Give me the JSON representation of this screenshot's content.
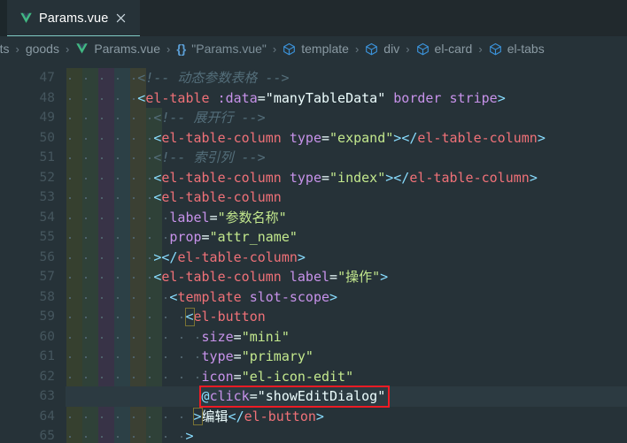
{
  "window": {
    "theme_bg": "#263238",
    "accent": "#80cbc4",
    "annotation_color": "#ee1b24"
  },
  "tabbar": {
    "tabs": [
      {
        "label": "Params.vue",
        "icon": "vue-icon",
        "close_icon": "close-icon",
        "active": true
      }
    ]
  },
  "breadcrumb": {
    "items": [
      {
        "label": "ents",
        "icon": null
      },
      {
        "label": "goods",
        "icon": null
      },
      {
        "label": "Params.vue",
        "icon": "vue-icon"
      },
      {
        "label": "\"Params.vue\"",
        "icon": "braces-icon"
      },
      {
        "label": "template",
        "icon": "cube-icon"
      },
      {
        "label": "div",
        "icon": "cube-icon"
      },
      {
        "label": "el-card",
        "icon": "cube-icon"
      },
      {
        "label": "el-tabs",
        "icon": "cube-icon"
      }
    ],
    "separator": "›"
  },
  "editor": {
    "first_line_number": 47,
    "current_line_number": 63,
    "line_numbers": [
      47,
      48,
      49,
      50,
      51,
      52,
      53,
      54,
      55,
      56,
      57,
      58,
      59,
      60,
      61,
      62,
      63,
      64,
      65
    ],
    "indent_band_colors": [
      "#36402f",
      "#2f4138",
      "#383347",
      "#2c4046",
      "#3b4033",
      "#2f4138"
    ],
    "lines": [
      {
        "n": 47,
        "indent": 9,
        "tokens": [
          {
            "t": "<!-- 动态参数表格 -->",
            "c": "t-cmt"
          }
        ]
      },
      {
        "n": 48,
        "indent": 9,
        "tokens": [
          {
            "t": "<",
            "c": "t-brk"
          },
          {
            "t": "el-table",
            "c": "t-pnk"
          },
          {
            "t": " ",
            "c": "t-wht"
          },
          {
            "t": ":data",
            "c": "t-pur"
          },
          {
            "t": "=",
            "c": "t-wht"
          },
          {
            "t": "\"",
            "c": "t-wht"
          },
          {
            "t": "manyTableData",
            "c": "t-wht"
          },
          {
            "t": "\"",
            "c": "t-wht"
          },
          {
            "t": " ",
            "c": "t-wht"
          },
          {
            "t": "border",
            "c": "t-pur"
          },
          {
            "t": " ",
            "c": "t-wht"
          },
          {
            "t": "stripe",
            "c": "t-pur"
          },
          {
            "t": ">",
            "c": "t-brk"
          }
        ]
      },
      {
        "n": 49,
        "indent": 11,
        "tokens": [
          {
            "t": "<!-- 展开行 -->",
            "c": "t-cmt"
          }
        ]
      },
      {
        "n": 50,
        "indent": 11,
        "tokens": [
          {
            "t": "<",
            "c": "t-brk"
          },
          {
            "t": "el-table-column",
            "c": "t-pnk"
          },
          {
            "t": " ",
            "c": "t-wht"
          },
          {
            "t": "type",
            "c": "t-pur"
          },
          {
            "t": "=",
            "c": "t-wht"
          },
          {
            "t": "\"expand\"",
            "c": "t-grn"
          },
          {
            "t": ">",
            "c": "t-brk"
          },
          {
            "t": "</",
            "c": "t-brk"
          },
          {
            "t": "el-table-column",
            "c": "t-pnk"
          },
          {
            "t": ">",
            "c": "t-brk"
          }
        ]
      },
      {
        "n": 51,
        "indent": 11,
        "tokens": [
          {
            "t": "<!-- 索引列 -->",
            "c": "t-cmt"
          }
        ]
      },
      {
        "n": 52,
        "indent": 11,
        "tokens": [
          {
            "t": "<",
            "c": "t-brk"
          },
          {
            "t": "el-table-column",
            "c": "t-pnk"
          },
          {
            "t": " ",
            "c": "t-wht"
          },
          {
            "t": "type",
            "c": "t-pur"
          },
          {
            "t": "=",
            "c": "t-wht"
          },
          {
            "t": "\"index\"",
            "c": "t-grn"
          },
          {
            "t": ">",
            "c": "t-brk"
          },
          {
            "t": "</",
            "c": "t-brk"
          },
          {
            "t": "el-table-column",
            "c": "t-pnk"
          },
          {
            "t": ">",
            "c": "t-brk"
          }
        ]
      },
      {
        "n": 53,
        "indent": 11,
        "tokens": [
          {
            "t": "<",
            "c": "t-brk"
          },
          {
            "t": "el-table-column",
            "c": "t-pnk"
          }
        ]
      },
      {
        "n": 54,
        "indent": 13,
        "tokens": [
          {
            "t": "label",
            "c": "t-pur"
          },
          {
            "t": "=",
            "c": "t-wht"
          },
          {
            "t": "\"参数名称\"",
            "c": "t-grn"
          }
        ]
      },
      {
        "n": 55,
        "indent": 13,
        "tokens": [
          {
            "t": "prop",
            "c": "t-pur"
          },
          {
            "t": "=",
            "c": "t-wht"
          },
          {
            "t": "\"attr_name\"",
            "c": "t-grn"
          }
        ]
      },
      {
        "n": 56,
        "indent": 11,
        "tokens": [
          {
            "t": ">",
            "c": "t-brk"
          },
          {
            "t": "</",
            "c": "t-brk"
          },
          {
            "t": "el-table-column",
            "c": "t-pnk"
          },
          {
            "t": ">",
            "c": "t-brk"
          }
        ]
      },
      {
        "n": 57,
        "indent": 11,
        "tokens": [
          {
            "t": "<",
            "c": "t-brk"
          },
          {
            "t": "el-table-column",
            "c": "t-pnk"
          },
          {
            "t": " ",
            "c": "t-wht"
          },
          {
            "t": "label",
            "c": "t-pur"
          },
          {
            "t": "=",
            "c": "t-wht"
          },
          {
            "t": "\"操作\"",
            "c": "t-grn"
          },
          {
            "t": ">",
            "c": "t-brk"
          }
        ]
      },
      {
        "n": 58,
        "indent": 13,
        "tokens": [
          {
            "t": "<",
            "c": "t-brk"
          },
          {
            "t": "template",
            "c": "t-pnk"
          },
          {
            "t": " ",
            "c": "t-wht"
          },
          {
            "t": "slot-scope",
            "c": "t-pur"
          },
          {
            "t": ">",
            "c": "t-brk"
          }
        ]
      },
      {
        "n": 59,
        "indent": 15,
        "tokens": [
          {
            "t": "<",
            "c": "t-brk"
          },
          {
            "t": "el-button",
            "c": "t-pnk"
          }
        ]
      },
      {
        "n": 60,
        "indent": 17,
        "tokens": [
          {
            "t": "size",
            "c": "t-pur"
          },
          {
            "t": "=",
            "c": "t-wht"
          },
          {
            "t": "\"mini\"",
            "c": "t-grn"
          }
        ]
      },
      {
        "n": 61,
        "indent": 17,
        "tokens": [
          {
            "t": "type",
            "c": "t-pur"
          },
          {
            "t": "=",
            "c": "t-wht"
          },
          {
            "t": "\"primary\"",
            "c": "t-grn"
          }
        ]
      },
      {
        "n": 62,
        "indent": 17,
        "tokens": [
          {
            "t": "icon",
            "c": "t-pur"
          },
          {
            "t": "=",
            "c": "t-wht"
          },
          {
            "t": "\"el-icon-edit\"",
            "c": "t-grn"
          }
        ]
      },
      {
        "n": 63,
        "indent": 17,
        "tokens": [
          {
            "t": "@",
            "c": "t-cn"
          },
          {
            "t": "click",
            "c": "t-pur"
          },
          {
            "t": "=",
            "c": "t-wht"
          },
          {
            "t": "\"showEditDialog\"",
            "c": "t-wht"
          }
        ]
      },
      {
        "n": 64,
        "indent": 16,
        "tokens": [
          {
            "t": ">",
            "c": "t-brk"
          },
          {
            "t": "编辑",
            "c": "t-wht"
          },
          {
            "t": "</",
            "c": "t-brk"
          },
          {
            "t": "el-button",
            "c": "t-pnk"
          },
          {
            "t": ">",
            "c": "t-brk"
          }
        ]
      },
      {
        "n": 65,
        "indent": 15,
        "tokens": [
          {
            "t": ">",
            "c": "t-brk"
          }
        ]
      }
    ],
    "annotation": {
      "kind": "red-rectangle",
      "target_text": "@click=\"showEditDialog\"",
      "on_line": 63
    },
    "bracket_matches": [
      {
        "line": 59,
        "char": "<"
      },
      {
        "line": 64,
        "char": ">"
      }
    ]
  }
}
